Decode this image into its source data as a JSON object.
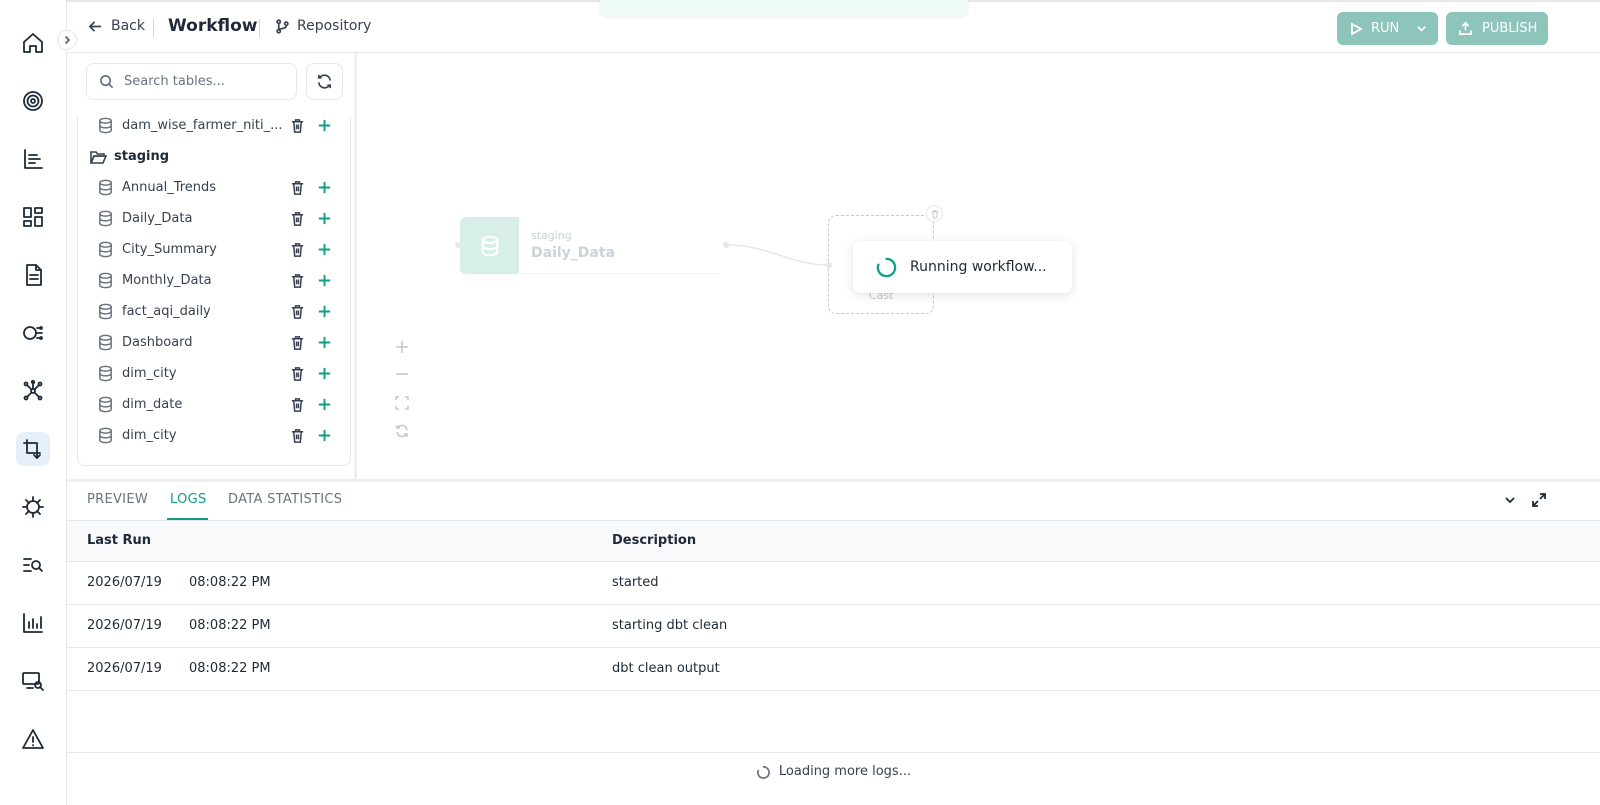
{
  "header": {
    "back_label": "Back",
    "title": "Workflow",
    "repository_label": "Repository",
    "run_label": "RUN",
    "publish_label": "PUBLISH"
  },
  "rail": {
    "icons": [
      "home-icon",
      "target-icon",
      "bar-list-icon",
      "dashboard-icon",
      "document-icon",
      "flow-icon",
      "network-icon",
      "transform-icon",
      "gear-bug-icon",
      "search-list-icon",
      "chart-icon",
      "monitor-search-icon",
      "warning-icon"
    ]
  },
  "tables_panel": {
    "search_placeholder": "Search tables...",
    "top_item": "dam_wise_farmer_niti_...",
    "folder": "staging",
    "items": [
      "Annual_Trends",
      "Daily_Data",
      "City_Summary",
      "Monthly_Data",
      "fact_aqi_daily",
      "Dashboard",
      "dim_city",
      "dim_date",
      "dim_city"
    ]
  },
  "canvas": {
    "source_node": {
      "schema": "staging",
      "table": "Daily_Data"
    },
    "cast_node": {
      "label": "Cast"
    },
    "status": "Running workflow..."
  },
  "bottom_panel": {
    "tabs": [
      "PREVIEW",
      "LOGS",
      "DATA STATISTICS"
    ],
    "active_tab": "LOGS",
    "columns": [
      "Last Run",
      "Description"
    ],
    "rows": [
      {
        "date": "2026/07/19",
        "time": "08:08:22 PM",
        "description": "started"
      },
      {
        "date": "2026/07/19",
        "time": "08:08:22 PM",
        "description": "starting dbt clean"
      },
      {
        "date": "2026/07/19",
        "time": "08:08:22 PM",
        "description": "dbt clean output"
      }
    ],
    "loading_text": "Loading more logs..."
  },
  "colors": {
    "accent": "#0f9d85",
    "button_disabled": "#8ec5bb",
    "rail_active": "#e6f0fb"
  }
}
